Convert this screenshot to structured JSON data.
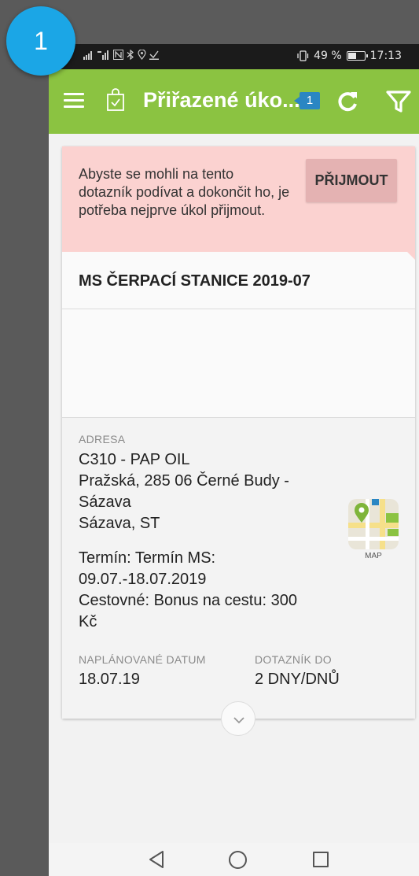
{
  "step_number": "1",
  "status_bar": {
    "left_icons": [
      "signal-icon",
      "lte-icon",
      "nfc-icon",
      "bluetooth-icon",
      "location-icon",
      "download-icon"
    ],
    "battery_percent": "49 %",
    "battery_level": 0.49,
    "time": "17:13"
  },
  "app_bar": {
    "title": "Přiřazené úko...",
    "badge_count": "1",
    "color": "#8bc341"
  },
  "task": {
    "alert": {
      "message": "Abyste se mohli na tento dotazník podívat a  dokončit ho, je potřeba nejprve úkol přijmout.",
      "accept_label": "PŘIJMOUT",
      "color": "#fbd2d0"
    },
    "title": "MS ČERPACÍ STANICE 2019-07",
    "address_label": "ADRESA",
    "address_lines": [
      "C310 - PAP OIL",
      "Pražská, 285 06 Černé Budy -",
      "Sázava",
      "Sázava, ST"
    ],
    "info_lines": [
      "Termín: Termín MS:",
      "09.07.-18.07.2019",
      "Cestovné: Bonus na cestu: 300",
      "Kč"
    ],
    "map_label": "MAP",
    "planned_date_label": "NAPLÁNOVANÉ DATUM",
    "planned_date": "18.07.19",
    "questionnaire_label": "DOTAZNÍK DO",
    "questionnaire_value": "2 DNY/DNŮ"
  },
  "nav_icons": [
    "back-icon",
    "home-icon",
    "recent-apps-icon"
  ]
}
